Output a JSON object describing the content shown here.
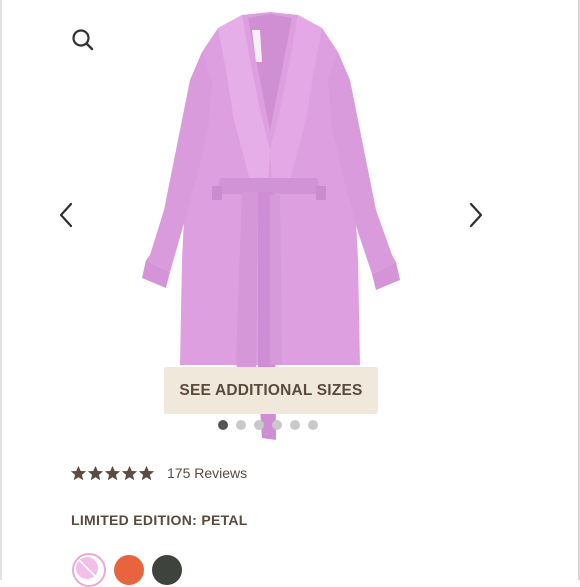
{
  "gallery": {
    "sizes_button_label": "SEE ADDITIONAL SIZES",
    "dot_count": 6,
    "active_dot": 0
  },
  "icons": {
    "search": "search-icon",
    "prev": "chevron-left-icon",
    "next": "chevron-right-icon",
    "star": "star-icon"
  },
  "rating": {
    "stars": 5,
    "reviews_label": "175 Reviews"
  },
  "product": {
    "color_label": "LIMITED EDITION: PETAL"
  },
  "swatches": [
    {
      "name": "petal",
      "color": "#f3bfe8",
      "selected": true
    },
    {
      "name": "orange",
      "color": "#e7643f",
      "selected": false
    },
    {
      "name": "dark",
      "color": "#3f433d",
      "selected": false
    }
  ],
  "colors": {
    "robe": "#df9fe2",
    "text": "#5a4a3e",
    "button_bg": "#f1e8dc",
    "star": "#5b4b42"
  }
}
